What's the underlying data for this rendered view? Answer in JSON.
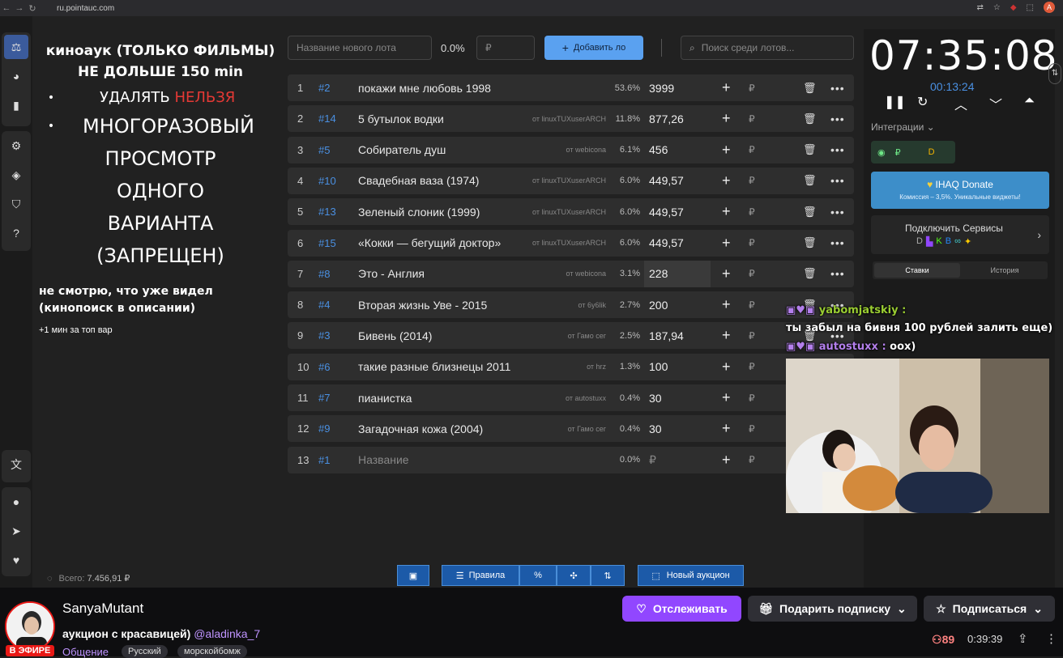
{
  "browser": {
    "url": "ru.pointauc.com",
    "avatar_letter": "A"
  },
  "notes": {
    "title_line1": "киноаук (ТОЛЬКО ФИЛЬМЫ)",
    "title_line2": "НЕ ДОЛЬШЕ 150 min",
    "bullet1_a": "УДАЛЯТЬ ",
    "bullet1_b": "НЕЛЬЗЯ",
    "bullet2": "МНОГОРАЗОВЫЙ",
    "line3": "ПРОСМОТР",
    "line4": "ОДНОГО",
    "line5": "ВАРИАНТА",
    "line6": "(ЗАПРЕЩЕН)",
    "small": "не смотрю, что уже видел (кинопоиск в описании)",
    "tiny": "+1 мин за топ вар"
  },
  "toolbar": {
    "lot_placeholder": "Название нового лота",
    "percent": "0.0%",
    "amount_placeholder": "₽",
    "add_label": "Добавить ло",
    "search_placeholder": "Поиск среди лотов..."
  },
  "lots": [
    {
      "num": "1",
      "id": "#2",
      "name": "покажи мне любовь 1998",
      "from": "",
      "pct": "53.6%",
      "amount": "3999"
    },
    {
      "num": "2",
      "id": "#14",
      "name": "5 бутылок водки",
      "from": "от linuxTUXuserARCH",
      "pct": "11.8%",
      "amount": "877,26"
    },
    {
      "num": "3",
      "id": "#5",
      "name": "Собиратель душ",
      "from": "от webicona",
      "pct": "6.1%",
      "amount": "456"
    },
    {
      "num": "4",
      "id": "#10",
      "name": "Свадебная ваза (1974)",
      "from": "от linuxTUXuserARCH",
      "pct": "6.0%",
      "amount": "449,57"
    },
    {
      "num": "5",
      "id": "#13",
      "name": "Зеленый слоник (1999)",
      "from": "от linuxTUXuserARCH",
      "pct": "6.0%",
      "amount": "449,57"
    },
    {
      "num": "6",
      "id": "#15",
      "name": "«Кокки — бегущий доктор»",
      "from": "от linuxTUXuserARCH",
      "pct": "6.0%",
      "amount": "449,57"
    },
    {
      "num": "7",
      "id": "#8",
      "name": "Это - Англия",
      "from": "от webicona",
      "pct": "3.1%",
      "amount": "228"
    },
    {
      "num": "8",
      "id": "#4",
      "name": "Вторая жизнь Уве - 2015",
      "from": "от 6y6lik",
      "pct": "2.7%",
      "amount": "200"
    },
    {
      "num": "9",
      "id": "#3",
      "name": "Бивень (2014)",
      "from": "от Гамо сег",
      "pct": "2.5%",
      "amount": "187,94"
    },
    {
      "num": "10",
      "id": "#6",
      "name": "такие разные близнецы 2011",
      "from": "от hrz",
      "pct": "1.3%",
      "amount": "100"
    },
    {
      "num": "11",
      "id": "#7",
      "name": "пианистка",
      "from": "от autostuxx",
      "pct": "0.4%",
      "amount": "30"
    },
    {
      "num": "12",
      "id": "#9",
      "name": "Загадочная кожа (2004)",
      "from": "от Гамо сег",
      "pct": "0.4%",
      "amount": "30"
    },
    {
      "num": "13",
      "id": "#1",
      "name": "Название",
      "from": "",
      "pct": "0.0%",
      "amount": "₽"
    }
  ],
  "currency": "₽",
  "bottom": {
    "total_label": "Всего:",
    "total_value": "7.456,91 ₽",
    "rules_label": "Правила",
    "new_auction_label": "Новый аукцион"
  },
  "timer": {
    "main": "07:35:08",
    "sub": "00:13:24"
  },
  "integrations": {
    "label": "Интеграции",
    "donate_title": "IHAQ Donate",
    "donate_sub": "Комиссия – 3,5%. Уникальные виджеты!",
    "services_title": "Подключить Сервисы",
    "tab_bids": "Ставки",
    "tab_history": "История"
  },
  "chat": [
    {
      "user": "yabomjatskiy :",
      "text": ""
    },
    {
      "user": "",
      "text": "ты забыл на бивня 100 рублей залить еще)"
    },
    {
      "user": "autostuxx :",
      "text": "оох)"
    }
  ],
  "stream": {
    "streamer": "SanyaMutant",
    "title": "аукцион с красавицей)",
    "mention": "@aladinka_7",
    "live": "В ЭФИРЕ",
    "category": "Общение",
    "tag1": "Русский",
    "tag2": "морскойбомж",
    "follow": "Отслеживать",
    "gift": "Подарить подписку",
    "subscribe": "Подписаться",
    "viewers": "89",
    "uptime": "0:39:39"
  },
  "colors": {
    "accent": "#5aa1f0",
    "twitch": "#9147ff",
    "red": "#e53935",
    "id_blue": "#4a90e2"
  }
}
